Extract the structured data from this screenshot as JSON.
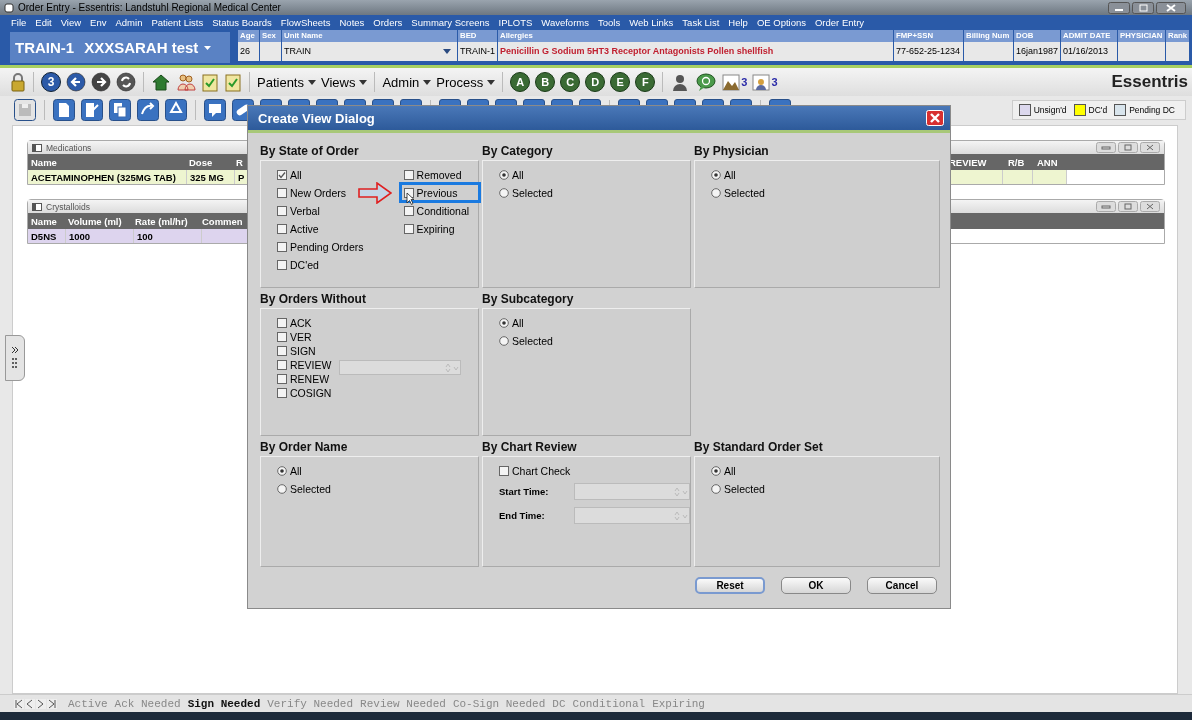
{
  "window": {
    "title": "Order Entry - Essentris: Landstuhl Regional Medical Center"
  },
  "menu": [
    "File",
    "Edit",
    "View",
    "Env",
    "Admin",
    "Patient Lists",
    "Status Boards",
    "FlowSheets",
    "Notes",
    "Orders",
    "Summary Screens",
    "IPLOTS",
    "Waveforms",
    "Tools",
    "Web Links",
    "Task List",
    "Help",
    "OE Options",
    "Order Entry"
  ],
  "patient": {
    "bed_id": "TRAIN-1",
    "name": "XXXSARAH test",
    "fields": [
      {
        "label": "Age",
        "value": "26"
      },
      {
        "label": "Sex"
      },
      {
        "label": "Unit Name",
        "value": "TRAIN",
        "kind": "dropdown"
      },
      {
        "label": "BED",
        "value": "TRAIN-1"
      },
      {
        "label": "Allergies",
        "value": "Penicillin G Sodium 5HT3 Receptor Antagonists Pollen shellfish",
        "kind": "alert"
      },
      {
        "label": "FMP+SSN",
        "value": "77-652-25-1234"
      },
      {
        "label": "Billing Num"
      },
      {
        "label": "DOB",
        "value": "16jan1987"
      },
      {
        "label": "ADMIT DATE",
        "value": "01/16/2013"
      },
      {
        "label": "PHYSICIAN"
      },
      {
        "label": "Rank"
      }
    ]
  },
  "toolbar": {
    "badge": "3",
    "menus": [
      "Patients",
      "Views",
      "Admin",
      "Process"
    ],
    "letters": [
      "A",
      "B",
      "C",
      "D",
      "E",
      "F"
    ],
    "counts": [
      "3",
      "3"
    ],
    "brand": "Essentris"
  },
  "legend": [
    {
      "label": "Unsign'd",
      "color": "#dcd8ee"
    },
    {
      "label": "DC'd",
      "color": "#ffff00"
    },
    {
      "label": "Pending DC",
      "color": "#d8e4ec"
    }
  ],
  "medications": {
    "title": "Medications",
    "columns_left": [
      "Name",
      "Dose",
      "R"
    ],
    "columns_right": [
      "REVIEW",
      "R/B",
      "ANN"
    ],
    "row_left": [
      "ACETAMINOPHEN (325MG TAB)",
      "325 MG",
      "P"
    ]
  },
  "crystalloids": {
    "title": "Crystalloids",
    "columns": [
      "Name",
      "Volume (ml)",
      "Rate (ml/hr)",
      "Commen"
    ],
    "row": [
      "D5NS",
      "1000",
      "100"
    ]
  },
  "dialog": {
    "title": "Create View Dialog",
    "state_of_order": {
      "title": "By State of Order",
      "columns": [
        [
          {
            "label": "All",
            "checked": true
          },
          {
            "label": "New Orders",
            "checked": false
          },
          {
            "label": "Verbal",
            "checked": false
          },
          {
            "label": "Active",
            "checked": false
          },
          {
            "label": "Pending Orders",
            "checked": false
          },
          {
            "label": "DC'ed",
            "checked": false
          }
        ],
        [
          {
            "label": "Removed",
            "checked": false
          },
          {
            "label": "Previous",
            "checked": false,
            "highlighted": true
          },
          {
            "label": "Conditional",
            "checked": false
          },
          {
            "label": "Expiring",
            "checked": false
          }
        ]
      ]
    },
    "category": {
      "title": "By Category",
      "options": [
        {
          "label": "All",
          "selected": true
        },
        {
          "label": "Selected",
          "selected": false
        }
      ]
    },
    "physician": {
      "title": "By Physician",
      "options": [
        {
          "label": "All",
          "selected": true
        },
        {
          "label": "Selected",
          "selected": false
        }
      ]
    },
    "orders_without": {
      "title": "By Orders Without",
      "items": [
        {
          "label": "ACK",
          "checked": false
        },
        {
          "label": "VER",
          "checked": false
        },
        {
          "label": "SIGN",
          "checked": false
        },
        {
          "label": "REVIEW",
          "checked": false
        },
        {
          "label": "RENEW",
          "checked": false
        },
        {
          "label": "COSIGN",
          "checked": false
        }
      ]
    },
    "subcategory": {
      "title": "By Subcategory",
      "options": [
        {
          "label": "All",
          "selected": true
        },
        {
          "label": "Selected",
          "selected": false
        }
      ]
    },
    "order_name": {
      "title": "By Order Name",
      "options": [
        {
          "label": "All",
          "selected": true
        },
        {
          "label": "Selected",
          "selected": false
        }
      ]
    },
    "chart_review": {
      "title": "By Chart Review",
      "chart_check": {
        "label": "Chart Check",
        "checked": false
      },
      "start_label": "Start Time:",
      "end_label": "End Time:"
    },
    "standard_order_set": {
      "title": "By Standard Order Set",
      "options": [
        {
          "label": "All",
          "selected": true
        },
        {
          "label": "Selected",
          "selected": false
        }
      ]
    },
    "buttons": [
      "Reset",
      "OK",
      "Cancel"
    ]
  },
  "tabs": [
    {
      "label": "Active",
      "selected": false
    },
    {
      "label": "Ack Needed",
      "selected": false
    },
    {
      "label": "Sign Needed",
      "selected": true
    },
    {
      "label": "Verify Needed",
      "selected": false
    },
    {
      "label": "Review Needed",
      "selected": false
    },
    {
      "label": "Co-Sign Needed",
      "selected": false
    },
    {
      "label": "DC",
      "selected": false
    },
    {
      "label": "Conditional",
      "selected": false
    },
    {
      "label": "Expiring",
      "selected": false
    }
  ]
}
